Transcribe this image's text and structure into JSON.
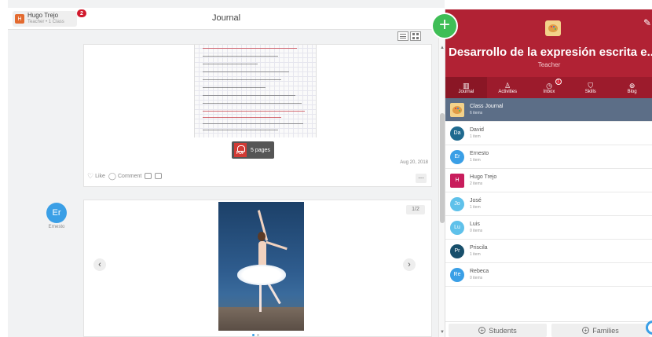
{
  "user": {
    "initial": "H",
    "name": "Hugo Trejo",
    "role": "Teacher • 1 Class",
    "notifications": "2"
  },
  "journal": {
    "title": "Journal",
    "post1": {
      "pdf_label": "5 pages",
      "pdf_badge": "PDF",
      "date": "Aug 20, 2018",
      "like": "Like",
      "comment": "Comment",
      "more": "..."
    },
    "post2": {
      "counter": "1/2",
      "prev": "‹",
      "next": "›"
    },
    "student": {
      "initials": "Er",
      "name": "Ernesto"
    }
  },
  "class_panel": {
    "name": "Desarrollo de la expresión escrita e...",
    "role": "Teacher",
    "tabs": [
      {
        "label": "Journal",
        "glyph": "▥"
      },
      {
        "label": "Activities",
        "glyph": "♙"
      },
      {
        "label": "Inbox",
        "glyph": "◷",
        "badge": "1"
      },
      {
        "label": "Skills",
        "glyph": "⛉"
      },
      {
        "label": "Blog",
        "glyph": "⊕"
      }
    ],
    "roster": [
      {
        "initials": "",
        "name": "Class Journal",
        "count": "6 items",
        "color": "#f3d28a"
      },
      {
        "initials": "Da",
        "name": "David",
        "count": "1 item",
        "color": "#1f6a8f"
      },
      {
        "initials": "Er",
        "name": "Ernesto",
        "count": "1 item",
        "color": "#3a9fe6"
      },
      {
        "initials": "H",
        "name": "Hugo Trejo",
        "count": "2 items",
        "color": "#c81d5c"
      },
      {
        "initials": "Jo",
        "name": "José",
        "count": "1 item",
        "color": "#5fc1ea"
      },
      {
        "initials": "Lu",
        "name": "Luis",
        "count": "0 items",
        "color": "#5fc1ea"
      },
      {
        "initials": "Pr",
        "name": "Priscila",
        "count": "1 item",
        "color": "#184f6b"
      },
      {
        "initials": "Re",
        "name": "Rebeca",
        "count": "0 items",
        "color": "#3a9fe6"
      }
    ],
    "add_students": "Students",
    "add_families": "Families"
  },
  "colors": {
    "accent_red": "#b12234",
    "fab_green": "#3fbe56",
    "link_blue": "#3a9fe6"
  },
  "icons": {
    "fab": "+",
    "edit": "✎",
    "heart": "♡",
    "comment": "◯"
  }
}
